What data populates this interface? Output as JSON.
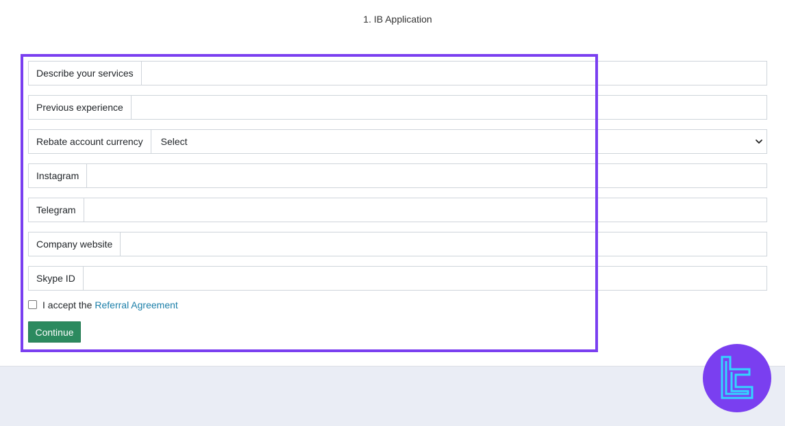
{
  "page": {
    "title": "1. IB Application"
  },
  "form": {
    "fields": [
      {
        "label": "Describe your services",
        "value": ""
      },
      {
        "label": "Previous experience",
        "value": ""
      },
      {
        "label": "Rebate account currency",
        "selected": "Select"
      },
      {
        "label": "Instagram",
        "value": ""
      },
      {
        "label": "Telegram",
        "value": ""
      },
      {
        "label": "Company website",
        "value": ""
      },
      {
        "label": "Skype ID",
        "value": ""
      }
    ],
    "accept_text": "I accept the",
    "agreement_link": "Referral Agreement",
    "continue_label": "Continue"
  },
  "colors": {
    "highlight": "#7a3ff0",
    "button": "#2c8a5f",
    "link": "#1a7ea8",
    "logo_bg": "#7a3ff0",
    "logo_fg": "#33d6ff"
  },
  "icons": {
    "select_arrow": "chevron-down-icon",
    "logo": "brand-logo-icon"
  }
}
